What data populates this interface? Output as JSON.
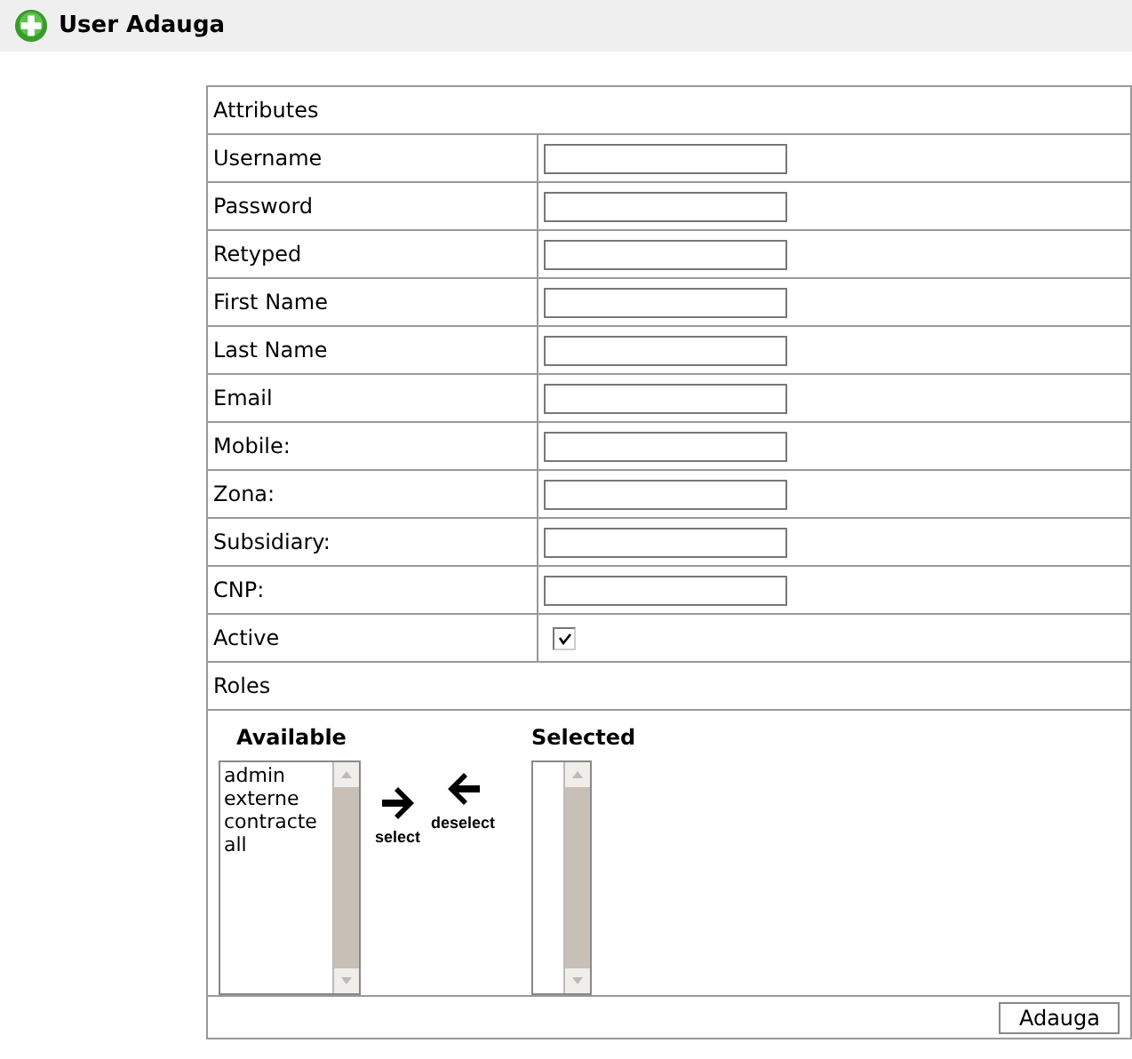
{
  "header": {
    "title": "User Adauga"
  },
  "form": {
    "section_title": "Attributes",
    "fields": [
      {
        "label": "Username",
        "kind": "text"
      },
      {
        "label": "Password",
        "kind": "text"
      },
      {
        "label": "Retyped",
        "kind": "text"
      },
      {
        "label": "First Name",
        "kind": "text"
      },
      {
        "label": "Last Name",
        "kind": "text"
      },
      {
        "label": "Email",
        "kind": "text"
      },
      {
        "label": "Mobile:",
        "kind": "text"
      },
      {
        "label": "Zona:",
        "kind": "text"
      },
      {
        "label": "Subsidiary:",
        "kind": "text"
      },
      {
        "label": "CNP:",
        "kind": "text"
      },
      {
        "label": "Active",
        "kind": "checkbox",
        "checked": true
      }
    ],
    "roles": {
      "title": "Roles",
      "available_title": "Available",
      "selected_title": "Selected",
      "available": [
        "admin",
        "externe",
        "contracte",
        "all"
      ],
      "select_label": "select",
      "deselect_label": "deselect"
    },
    "submit": "Adauga"
  }
}
